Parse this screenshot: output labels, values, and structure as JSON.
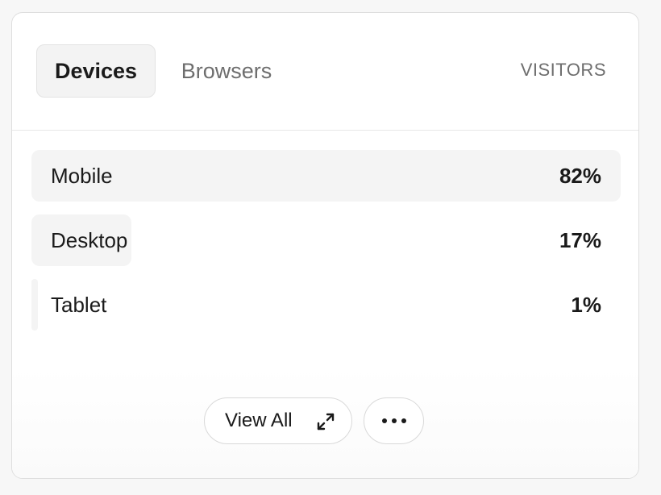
{
  "tabs": [
    {
      "label": "Devices",
      "active": true
    },
    {
      "label": "Browsers",
      "active": false
    }
  ],
  "column_label": "VISITORS",
  "rows": [
    {
      "label": "Mobile",
      "value": "82%",
      "fraction": 0.82
    },
    {
      "label": "Desktop",
      "value": "17%",
      "fraction": 0.17
    },
    {
      "label": "Tablet",
      "value": "1%",
      "fraction": 0.01
    }
  ],
  "footer": {
    "view_all_label": "View All",
    "view_all_icon": "expand-icon",
    "more_icon": "more-horizontal-icon"
  },
  "colors": {
    "row_bar": "#f4f4f4",
    "active_tab_bg": "#f3f3f3",
    "muted_text": "#6e6e6e"
  }
}
